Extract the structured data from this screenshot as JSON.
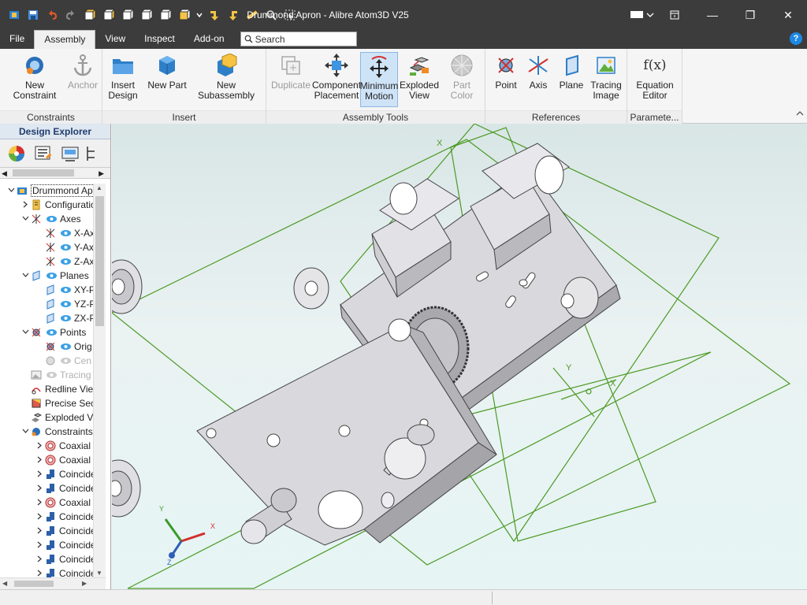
{
  "window": {
    "title": "Drummond Apron - Alibre Atom3D V25",
    "controls": {
      "minimize": "—",
      "restore": "❐",
      "close": "✕"
    }
  },
  "quick_access": [
    "app-icon",
    "save-icon",
    "undo-icon",
    "redo-icon",
    "view-front-icon",
    "view-back-icon",
    "view-left-icon",
    "view-right-icon",
    "view-top-icon",
    "view-iso-icon",
    "dropdown-icon",
    "arrow-down-icon",
    "arrow-turn-icon",
    "measure-icon",
    "zoom-icon",
    "select-icon"
  ],
  "menu": {
    "tabs": [
      "File",
      "Assembly",
      "View",
      "Inspect",
      "Add-on"
    ],
    "active_tab": "Assembly",
    "search_placeholder": "Search"
  },
  "ribbon": {
    "groups": [
      {
        "label": "Constraints",
        "buttons": [
          {
            "label": "New Constraint",
            "icon": "new-constraint-icon",
            "enabled": true
          },
          {
            "label": "Anchor",
            "icon": "anchor-icon",
            "enabled": false
          }
        ]
      },
      {
        "label": "Insert",
        "buttons": [
          {
            "label": "Insert\nDesign",
            "icon": "insert-design-icon",
            "enabled": true
          },
          {
            "label": "New Part",
            "icon": "new-part-icon",
            "enabled": true
          },
          {
            "label": "New Subassembly",
            "icon": "new-subassembly-icon",
            "enabled": true
          }
        ]
      },
      {
        "label": "Assembly Tools",
        "buttons": [
          {
            "label": "Duplicate",
            "icon": "duplicate-icon",
            "enabled": false
          },
          {
            "label": "Component\nPlacement",
            "icon": "component-placement-icon",
            "enabled": true
          },
          {
            "label": "Minimum\nMotion",
            "icon": "minimum-motion-icon",
            "enabled": true,
            "active": true
          },
          {
            "label": "Exploded\nView",
            "icon": "exploded-view-icon",
            "enabled": true
          },
          {
            "label": "Part Color",
            "icon": "part-color-icon",
            "enabled": false
          }
        ]
      },
      {
        "label": "References",
        "buttons": [
          {
            "label": "Point",
            "icon": "point-icon",
            "enabled": true
          },
          {
            "label": "Axis",
            "icon": "axis-icon",
            "enabled": true
          },
          {
            "label": "Plane",
            "icon": "plane-icon",
            "enabled": true
          },
          {
            "label": "Tracing\nImage",
            "icon": "tracing-image-icon",
            "enabled": true
          }
        ]
      },
      {
        "label": "Paramete...",
        "buttons": [
          {
            "label": "Equation\nEditor",
            "icon": "equation-editor-icon",
            "enabled": true,
            "glyph": "f(x)"
          }
        ]
      }
    ]
  },
  "explorer": {
    "title": "Design Explorer",
    "tree": [
      {
        "label": "Drummond Apro",
        "icon": "assembly-icon",
        "level": 0,
        "expand": "v",
        "eye": false
      },
      {
        "label": "Configuratio",
        "icon": "configuration-icon",
        "level": 1,
        "expand": ">",
        "eye": false
      },
      {
        "label": "Axes",
        "icon": "axes-icon",
        "level": 1,
        "expand": "v",
        "eye": true
      },
      {
        "label": "X-Ax",
        "icon": "axis-item-icon",
        "level": 2,
        "expand": "",
        "eye": true
      },
      {
        "label": "Y-Ax",
        "icon": "axis-item-icon",
        "level": 2,
        "expand": "",
        "eye": true
      },
      {
        "label": "Z-Ax",
        "icon": "axis-item-icon",
        "level": 2,
        "expand": "",
        "eye": true
      },
      {
        "label": "Planes",
        "icon": "planes-icon",
        "level": 1,
        "expand": "v",
        "eye": true
      },
      {
        "label": "XY-P",
        "icon": "plane-item-icon",
        "level": 2,
        "expand": "",
        "eye": true
      },
      {
        "label": "YZ-P",
        "icon": "plane-item-icon",
        "level": 2,
        "expand": "",
        "eye": true
      },
      {
        "label": "ZX-P",
        "icon": "plane-item-icon",
        "level": 2,
        "expand": "",
        "eye": true
      },
      {
        "label": "Points",
        "icon": "points-icon",
        "level": 1,
        "expand": "v",
        "eye": true
      },
      {
        "label": "Orig",
        "icon": "origin-icon",
        "level": 2,
        "expand": "",
        "eye": true
      },
      {
        "label": "Cen",
        "icon": "center-icon",
        "level": 2,
        "expand": "",
        "eye": true,
        "greyed": true
      },
      {
        "label": "Tracing",
        "icon": "tracing-icon",
        "level": 1,
        "expand": "",
        "eye": true,
        "greyed": true
      },
      {
        "label": "Redline View",
        "icon": "redline-icon",
        "level": 1,
        "expand": "",
        "eye": false
      },
      {
        "label": "Precise Sec",
        "icon": "precise-section-icon",
        "level": 1,
        "expand": "",
        "eye": false
      },
      {
        "label": "Exploded Vi",
        "icon": "exploded-views-icon",
        "level": 1,
        "expand": "",
        "eye": false
      },
      {
        "label": "Constraints",
        "icon": "constraints-icon",
        "level": 1,
        "expand": "v",
        "eye": false
      },
      {
        "label": "Coaxial",
        "icon": "coaxial-icon",
        "level": 2,
        "expand": ">",
        "eye": false
      },
      {
        "label": "Coaxial",
        "icon": "coaxial-icon",
        "level": 2,
        "expand": ">",
        "eye": false
      },
      {
        "label": "Coincide",
        "icon": "coincident-icon",
        "level": 2,
        "expand": ">",
        "eye": false
      },
      {
        "label": "Coincide",
        "icon": "coincident-icon",
        "level": 2,
        "expand": ">",
        "eye": false
      },
      {
        "label": "Coaxial",
        "icon": "coaxial-icon",
        "level": 2,
        "expand": ">",
        "eye": false
      },
      {
        "label": "Coincide",
        "icon": "coincident-icon",
        "level": 2,
        "expand": ">",
        "eye": false
      },
      {
        "label": "Coincide",
        "icon": "coincident-icon",
        "level": 2,
        "expand": ">",
        "eye": false
      },
      {
        "label": "Coincide",
        "icon": "coincident-icon",
        "level": 2,
        "expand": ">",
        "eye": false
      },
      {
        "label": "Coincide",
        "icon": "coincident-icon",
        "level": 2,
        "expand": ">",
        "eye": false
      },
      {
        "label": "Coincide",
        "icon": "coincident-icon",
        "level": 2,
        "expand": ">",
        "eye": false
      }
    ]
  },
  "viewport": {
    "triad": {
      "x": "X",
      "y": "Y",
      "z": "Z"
    },
    "plane_labels": [
      "X",
      "Y",
      "X",
      "Y"
    ]
  },
  "colors": {
    "titlebar": "#3c3c3c",
    "accent": "#1e88e5",
    "plane_green": "#4c9a24",
    "part_grey": "#d6d6da"
  }
}
